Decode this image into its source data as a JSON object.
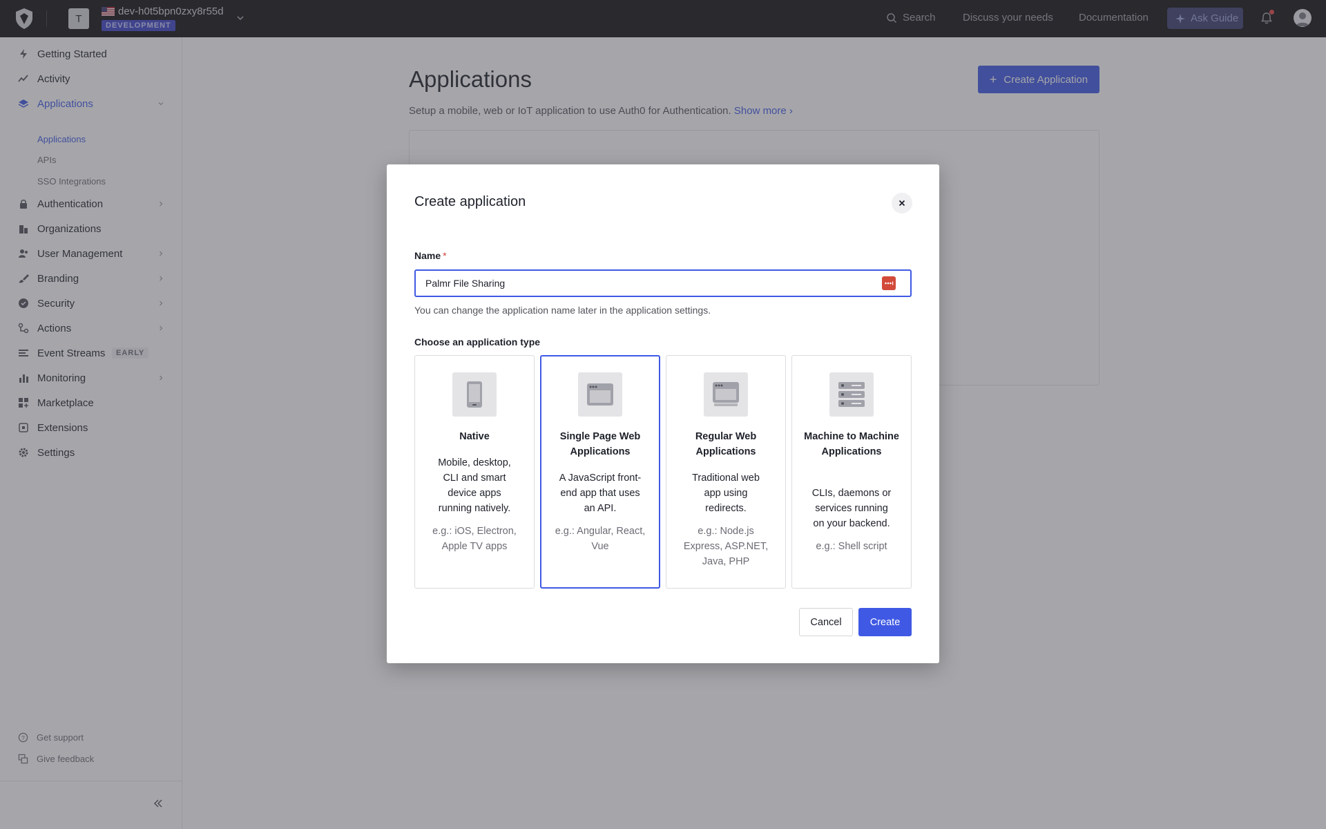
{
  "topbar": {
    "logo_icon": "auth0-shield-icon",
    "tenant_initial": "T",
    "tenant_name": "dev-h0t5bpn0zxy8r55d",
    "tenant_env": "DEVELOPMENT",
    "search_label": "Search",
    "discuss_label": "Discuss your needs",
    "docs_label": "Documentation",
    "ask_guide_label": "Ask Guide"
  },
  "sidebar": {
    "items": [
      {
        "label": "Getting Started",
        "icon": "bolt-icon"
      },
      {
        "label": "Activity",
        "icon": "activity-chart-icon"
      },
      {
        "label": "Applications",
        "icon": "layers-icon"
      },
      {
        "label": "Authentication",
        "icon": "lock-icon"
      },
      {
        "label": "Organizations",
        "icon": "building-icon"
      },
      {
        "label": "User Management",
        "icon": "users-icon"
      },
      {
        "label": "Branding",
        "icon": "brush-icon"
      },
      {
        "label": "Security",
        "icon": "shield-check-icon"
      },
      {
        "label": "Actions",
        "icon": "flow-icon"
      },
      {
        "label": "Event Streams",
        "icon": "stream-icon",
        "badge": "EARLY"
      },
      {
        "label": "Monitoring",
        "icon": "bar-chart-icon"
      },
      {
        "label": "Marketplace",
        "icon": "grid-plus-icon"
      },
      {
        "label": "Extensions",
        "icon": "puzzle-icon"
      },
      {
        "label": "Settings",
        "icon": "gear-icon"
      }
    ],
    "sub_items": [
      "Applications",
      "APIs",
      "SSO Integrations"
    ],
    "footer": {
      "support": "Get support",
      "feedback": "Give feedback"
    }
  },
  "main": {
    "title": "Applications",
    "create_button": "Create Application",
    "description": "Setup a mobile, web or IoT application to use Auth0 for Authentication.",
    "show_more": "Show more"
  },
  "modal": {
    "title": "Create application",
    "name_label": "Name",
    "required_mark": "*",
    "name_value": "Palmr File Sharing",
    "helper": "You can change the application name later in the application settings.",
    "type_label": "Choose an application type",
    "types": [
      {
        "title": "Native",
        "desc": "Mobile, desktop, CLI and smart device apps running natively.",
        "example": "e.g.: iOS, Electron, Apple TV apps",
        "icon": "phone-icon"
      },
      {
        "title": "Single Page Web Applications",
        "desc": "A JavaScript front-end app that uses an API.",
        "example": "e.g.: Angular, React, Vue",
        "icon": "browser-window-icon",
        "selected": true
      },
      {
        "title": "Regular Web Applications",
        "desc": "Traditional web app using redirects.",
        "example": "e.g.: Node.js Express, ASP.NET, Java, PHP",
        "icon": "server-window-icon"
      },
      {
        "title": "Machine to Machine Applications",
        "desc": "CLIs, daemons or services running on your backend.",
        "example": "e.g.: Shell script",
        "icon": "server-rack-icon"
      }
    ],
    "cancel": "Cancel",
    "create": "Create"
  },
  "colors": {
    "accent": "#3f59e4",
    "topbar": "#111113"
  }
}
